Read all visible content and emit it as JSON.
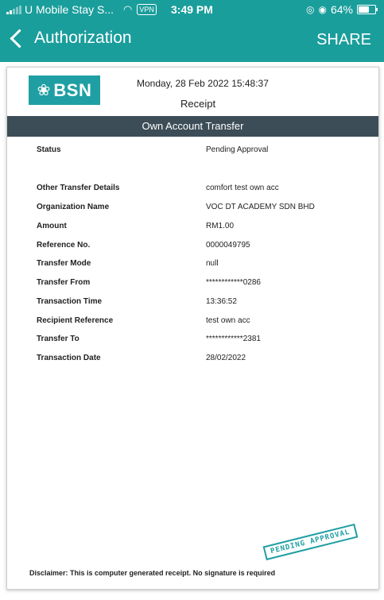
{
  "status_bar": {
    "carrier": "U Mobile Stay S...",
    "vpn": "VPN",
    "time": "3:49 PM",
    "battery_percent": "64%",
    "battery_level": 0.64
  },
  "nav": {
    "title": "Authorization",
    "share_label": "SHARE"
  },
  "receipt": {
    "logo_text": "BSN",
    "date": "Monday, 28 Feb 2022 15:48:37",
    "title": "Receipt",
    "section_title": "Own Account Transfer",
    "details": [
      {
        "label": "Status",
        "value": "Pending Approval"
      },
      {
        "label": "Other Transfer Details",
        "value": "comfort test own acc"
      },
      {
        "label": "Organization Name",
        "value": "VOC DT ACADEMY SDN BHD"
      },
      {
        "label": "Amount",
        "value": "RM1.00"
      },
      {
        "label": "Reference No.",
        "value": "0000049795"
      },
      {
        "label": "Transfer Mode",
        "value": "null"
      },
      {
        "label": "Transfer From",
        "value": "************0286"
      },
      {
        "label": "Transaction Time",
        "value": "13:36:52"
      },
      {
        "label": "Recipient Reference",
        "value": "test own acc"
      },
      {
        "label": "Transfer To",
        "value": "************2381"
      },
      {
        "label": "Transaction Date",
        "value": "28/02/2022"
      }
    ],
    "stamp": "PENDING APPROVAL",
    "disclaimer": "Disclaimer: This is computer generated receipt. No signature is required"
  },
  "colors": {
    "header": "#1a9e9c",
    "section_bar": "#3d4d57",
    "brand": "#1f9fa3"
  }
}
